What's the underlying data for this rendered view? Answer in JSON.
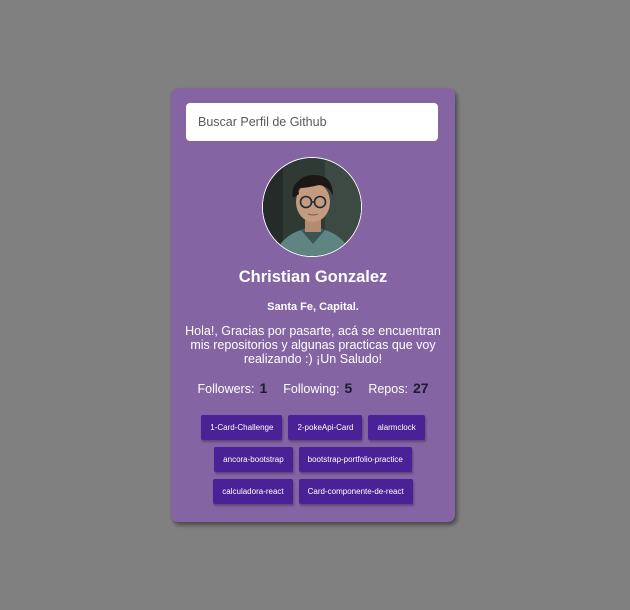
{
  "search": {
    "placeholder": "Buscar Perfil de Github"
  },
  "profile": {
    "name": "Christian Gonzalez",
    "location": "Santa Fe, Capital.",
    "bio": "Hola!, Gracias por pasarte, acá se encuentran mis repositorios y algunas practicas que voy realizando :) ¡Un Saludo!",
    "avatar_icon": "user-photo"
  },
  "stats": {
    "followers_label": "Followers:",
    "followers_value": "1",
    "following_label": "Following:",
    "following_value": "5",
    "repos_label": "Repos:",
    "repos_value": "27"
  },
  "repos": [
    "1-Card-Challenge",
    "2-pokeApi-Card",
    "alarmclock",
    "ancora-bootstrap",
    "bootstrap-portfolio-practice",
    "calculadora-react",
    "Card-componente-de-react"
  ],
  "colors": {
    "background": "#808080",
    "card": "#8564a4",
    "repo_button": "#4a2196",
    "stat_value": "#1e1b2b"
  }
}
